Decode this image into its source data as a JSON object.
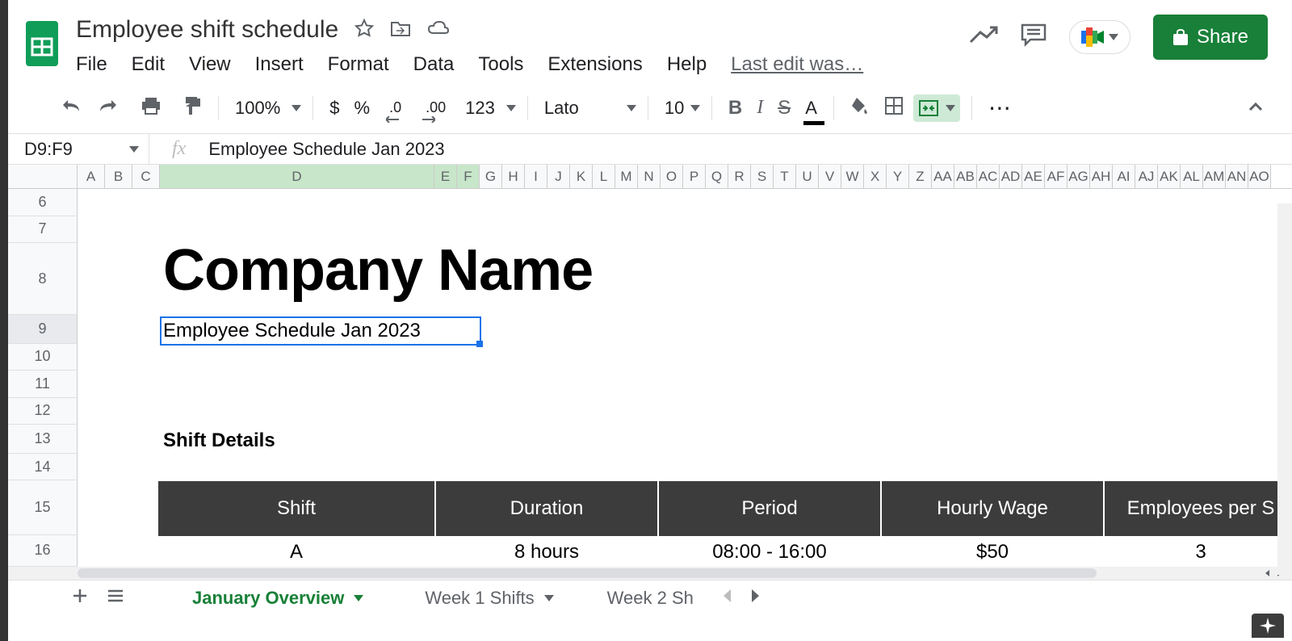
{
  "document": {
    "title": "Employee shift schedule",
    "last_edit": "Last edit was…"
  },
  "menu": {
    "file": "File",
    "edit": "Edit",
    "view": "View",
    "insert": "Insert",
    "format": "Format",
    "data": "Data",
    "tools": "Tools",
    "extensions": "Extensions",
    "help": "Help"
  },
  "toolbar": {
    "zoom": "100%",
    "currency": "$",
    "percent": "%",
    "dec_decrease": ".0",
    "dec_increase": ".00",
    "num_format": "123",
    "font": "Lato",
    "font_size": "10",
    "more": "⋯"
  },
  "name_box": "D9:F9",
  "formula_bar": "Employee Schedule Jan 2023",
  "share_label": "Share",
  "columns": [
    "A",
    "B",
    "C",
    "D",
    "E",
    "F",
    "G",
    "H",
    "I",
    "J",
    "K",
    "L",
    "M",
    "N",
    "O",
    "P",
    "Q",
    "R",
    "S",
    "T",
    "U",
    "V",
    "W",
    "X",
    "Y",
    "Z",
    "AA",
    "AB",
    "AC",
    "AD",
    "AE",
    "AF",
    "AG",
    "AH",
    "AI",
    "AJ",
    "AK",
    "AL",
    "AM",
    "AN",
    "AO"
  ],
  "rows": [
    "6",
    "7",
    "8",
    "9",
    "10",
    "11",
    "12",
    "13",
    "14",
    "15",
    "16"
  ],
  "content": {
    "company_name": "Company Name",
    "subtitle": "Employee Schedule Jan 2023",
    "shift_details_label": "Shift Details",
    "table": {
      "headers": [
        "Shift",
        "Duration",
        "Period",
        "Hourly Wage",
        "Employees per S"
      ],
      "row1": [
        "A",
        "8 hours",
        "08:00 - 16:00",
        "$50",
        "3"
      ]
    }
  },
  "tabs": {
    "active": "January Overview",
    "tab2": "Week 1 Shifts",
    "tab3": "Week 2 Sh"
  }
}
